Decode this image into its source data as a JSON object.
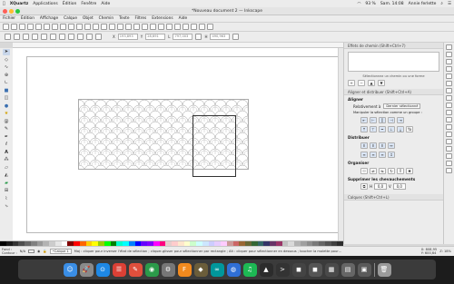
{
  "macos_menubar": {
    "apple": "",
    "items": [
      "XQuartz",
      "Applications",
      "Édition",
      "Fenêtre",
      "Aide"
    ],
    "battery": "93 %",
    "clock": "Sam. 14:08",
    "user": "Annie ferlette"
  },
  "window": {
    "title": "*Nouveau document 2 — Inkscape"
  },
  "menu": {
    "items": [
      "Fichier",
      "Édition",
      "Affichage",
      "Calque",
      "Objet",
      "Chemin",
      "Texte",
      "Filtres",
      "Extensions",
      "Aide"
    ]
  },
  "controls": {
    "x_value": "193,893",
    "y_value": "28,691",
    "w_value": "797,003",
    "h_value": "490,963"
  },
  "dock_panels": {
    "path_effects": {
      "title": "Effets de chemin (Shift+Ctrl+7)",
      "hint": "Sélectionnez un chemin ou une forme"
    },
    "align": {
      "title": "Aligner et distribuer (Shift+Ctrl+A)",
      "section_align": "Aligner",
      "relative_label": "Relativement à",
      "relative_value": "Dernier sélectionné",
      "group_label": "Manipuler la sélection comme un groupe :",
      "section_distribute": "Distribuer",
      "section_organize": "Organiser",
      "section_overlaps": "Supprimer les chevauchements",
      "h_gap": "0,0",
      "v_gap": "0,0"
    },
    "layers": {
      "title": "Calques (Shift+Ctrl+L)"
    }
  },
  "status": {
    "fill_label": "Fond :",
    "stroke_label": "Contour :",
    "fill_value": "N/A",
    "layer": "•Calque 1",
    "message": "Maj : cliquer pour inverser l'état de sélection ; cliquer-glisser pour sélectionner par rectangle ; Alt : cliquer pour sélectionner en dessous ; toucher la molette pour…",
    "x_coord": "X: 808,95",
    "y_coord": "Y: 600,64",
    "zoom": "Z: 18%"
  },
  "palette": {
    "colors": [
      "#000000",
      "#1a1a1a",
      "#333333",
      "#4d4d4d",
      "#666666",
      "#808080",
      "#999999",
      "#b3b3b3",
      "#cccccc",
      "#e6e6e6",
      "#ffffff",
      "#800000",
      "#ff0000",
      "#ff6600",
      "#ffcc00",
      "#ffff00",
      "#99cc00",
      "#00ff00",
      "#008000",
      "#00ffcc",
      "#00ffff",
      "#0080ff",
      "#0000ff",
      "#6600ff",
      "#8000ff",
      "#ff00ff",
      "#ff0080",
      "#e6cccc",
      "#ffcccc",
      "#ffe6cc",
      "#ffffcc",
      "#ccffcc",
      "#ccffff",
      "#cce6ff",
      "#ccccff",
      "#e6ccff",
      "#ffccff",
      "#cc9999",
      "#cc6666",
      "#996633",
      "#666633",
      "#336633",
      "#336666",
      "#333366",
      "#663366",
      "#993366",
      "#c0c0c0",
      "#d9d9d9",
      "#b3b3b3",
      "#9f9f9f",
      "#8c8c8c",
      "#797979",
      "#666666",
      "#535353",
      "#404040",
      "#2d2d2d"
    ]
  },
  "dock_apps": [
    {
      "name": "finder",
      "color": "#3a8ee6",
      "glyph": "☺"
    },
    {
      "name": "launchpad",
      "color": "#8a8a8a",
      "glyph": "🚀"
    },
    {
      "name": "safari",
      "color": "#1e88e5",
      "glyph": "⊙"
    },
    {
      "name": "todoist",
      "color": "#db4035",
      "glyph": "☰"
    },
    {
      "name": "sketch",
      "color": "#e04f3c",
      "glyph": "✎"
    },
    {
      "name": "chrome",
      "color": "#2b9a4a",
      "glyph": "◉"
    },
    {
      "name": "system-prefs",
      "color": "#777777",
      "glyph": "⚙"
    },
    {
      "name": "fontlab",
      "color": "#f28a1e",
      "glyph": "F"
    },
    {
      "name": "gimp",
      "color": "#6b5d3a",
      "glyph": "◆"
    },
    {
      "name": "arduino",
      "color": "#00979c",
      "glyph": "∞"
    },
    {
      "name": "blue-app",
      "color": "#2f6fd6",
      "glyph": "◍"
    },
    {
      "name": "spotify",
      "color": "#1db954",
      "glyph": "♫"
    },
    {
      "name": "inkscape",
      "color": "#2c2c2c",
      "glyph": "▲"
    },
    {
      "name": "terminal",
      "color": "#333333",
      "glyph": ">"
    },
    {
      "name": "dark-app",
      "color": "#444444",
      "glyph": "◼"
    },
    {
      "name": "app-a",
      "color": "#555555",
      "glyph": "◼"
    },
    {
      "name": "app-b",
      "color": "#4a4a4a",
      "glyph": "▦"
    },
    {
      "name": "app-c",
      "color": "#666666",
      "glyph": "▤"
    },
    {
      "name": "app-d",
      "color": "#5a5a5a",
      "glyph": "▣"
    },
    {
      "name": "trash",
      "color": "#9a9a9a",
      "glyph": "🗑"
    }
  ]
}
